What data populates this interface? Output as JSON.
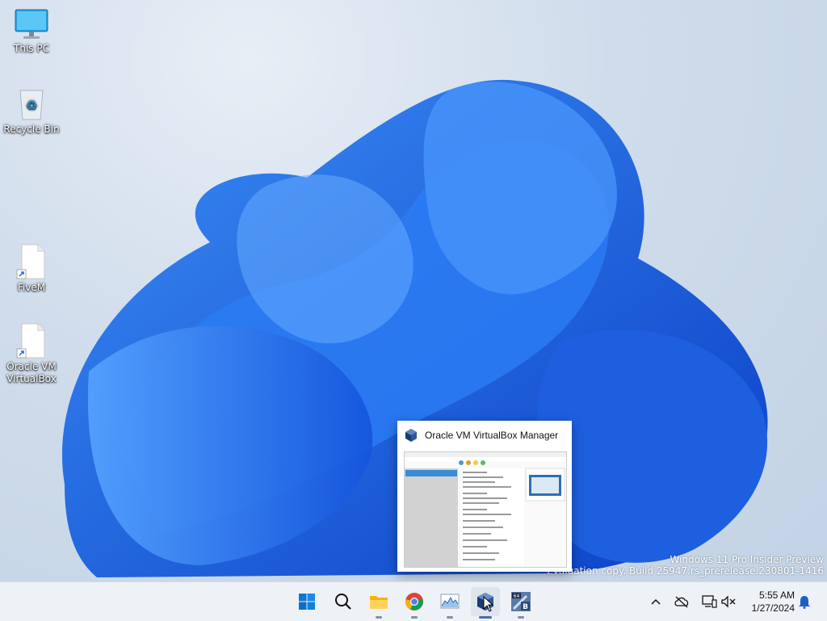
{
  "desktop": {
    "icons": [
      {
        "label": "This PC"
      },
      {
        "label": "Recycle Bin"
      },
      {
        "label": "FiveM"
      },
      {
        "label": "Oracle VM VirtualBox"
      }
    ]
  },
  "watermark": {
    "line1": "Windows 11 Pro Insider Preview",
    "line2": "Evaluation copy. Build 25947.rs_prerelease.230801-1416"
  },
  "preview": {
    "title": "Oracle VM VirtualBox Manager"
  },
  "taskbar": {
    "apps": [
      "start-icon",
      "search-icon",
      "file-explorer-icon",
      "chrome-icon",
      "performance-monitor-icon",
      "virtualbox-icon",
      "app-64b-icon"
    ]
  },
  "tray": {
    "time": "5:55 AM",
    "date": "1/27/2024"
  },
  "colors": {
    "accent": "#0067c0",
    "bloom": "#1a6cf0",
    "taskbar": "#eef1f6"
  }
}
